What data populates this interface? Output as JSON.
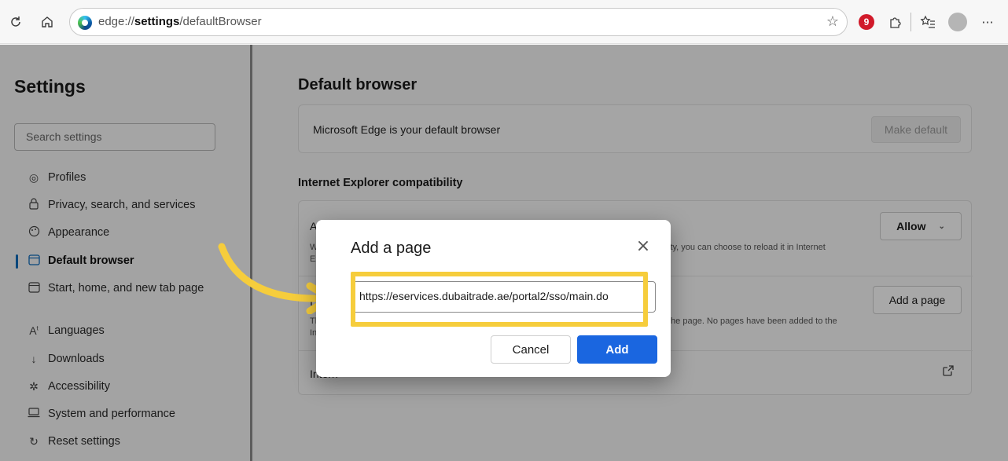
{
  "browser": {
    "url_prefix": "edge://",
    "url_bold": "settings",
    "url_suffix": "/defaultBrowser",
    "extension_badge": "9",
    "icons": {
      "refresh": "refresh-icon",
      "home": "home-icon",
      "favorite": "star-icon",
      "extensions": "puzzle-icon",
      "favorites_list": "favorites-icon",
      "profile": "avatar",
      "more": "more-icon"
    }
  },
  "sidebar": {
    "title": "Settings",
    "search_placeholder": "Search settings",
    "items": [
      {
        "label": "Profiles",
        "icon": "profile-icon"
      },
      {
        "label": "Privacy, search, and services",
        "icon": "lock-icon"
      },
      {
        "label": "Appearance",
        "icon": "palette-icon"
      },
      {
        "label": "Default browser",
        "icon": "browser-icon",
        "active": true
      },
      {
        "label": "Start, home, and new tab page",
        "icon": "window-icon"
      },
      {
        "label": "Languages",
        "icon": "languages-icon"
      },
      {
        "label": "Downloads",
        "icon": "download-icon"
      },
      {
        "label": "Accessibility",
        "icon": "accessibility-icon"
      },
      {
        "label": "System and performance",
        "icon": "laptop-icon"
      },
      {
        "label": "Reset settings",
        "icon": "reset-icon"
      }
    ]
  },
  "main": {
    "title": "Default browser",
    "default_text": "Microsoft Edge is your default browser",
    "make_default_label": "Make default",
    "ie_section_title": "Internet Explorer compatibility",
    "allow_row_title": "Allow",
    "allow_row_desc_1": "When",
    "allow_row_desc_right": "ity, you can choose to reload it in Internet",
    "allow_row_desc_2": "Explor",
    "allow_button": "Allow",
    "pages_row_title": "I",
    "pages_row_desc_1": "These",
    "pages_row_desc_right": "the page. No pages have been added to the",
    "pages_row_desc_2": "Intern",
    "add_page_button": "Add a page",
    "options_row_title": "Intern"
  },
  "dialog": {
    "title": "Add a page",
    "input_value": "https://eservices.dubaitrade.ae/portal2/sso/main.do",
    "cancel_label": "Cancel",
    "add_label": "Add"
  },
  "colors": {
    "highlight": "#f6cd3c",
    "primary_button": "#1a66e0",
    "active_indicator": "#0f6cbd"
  }
}
